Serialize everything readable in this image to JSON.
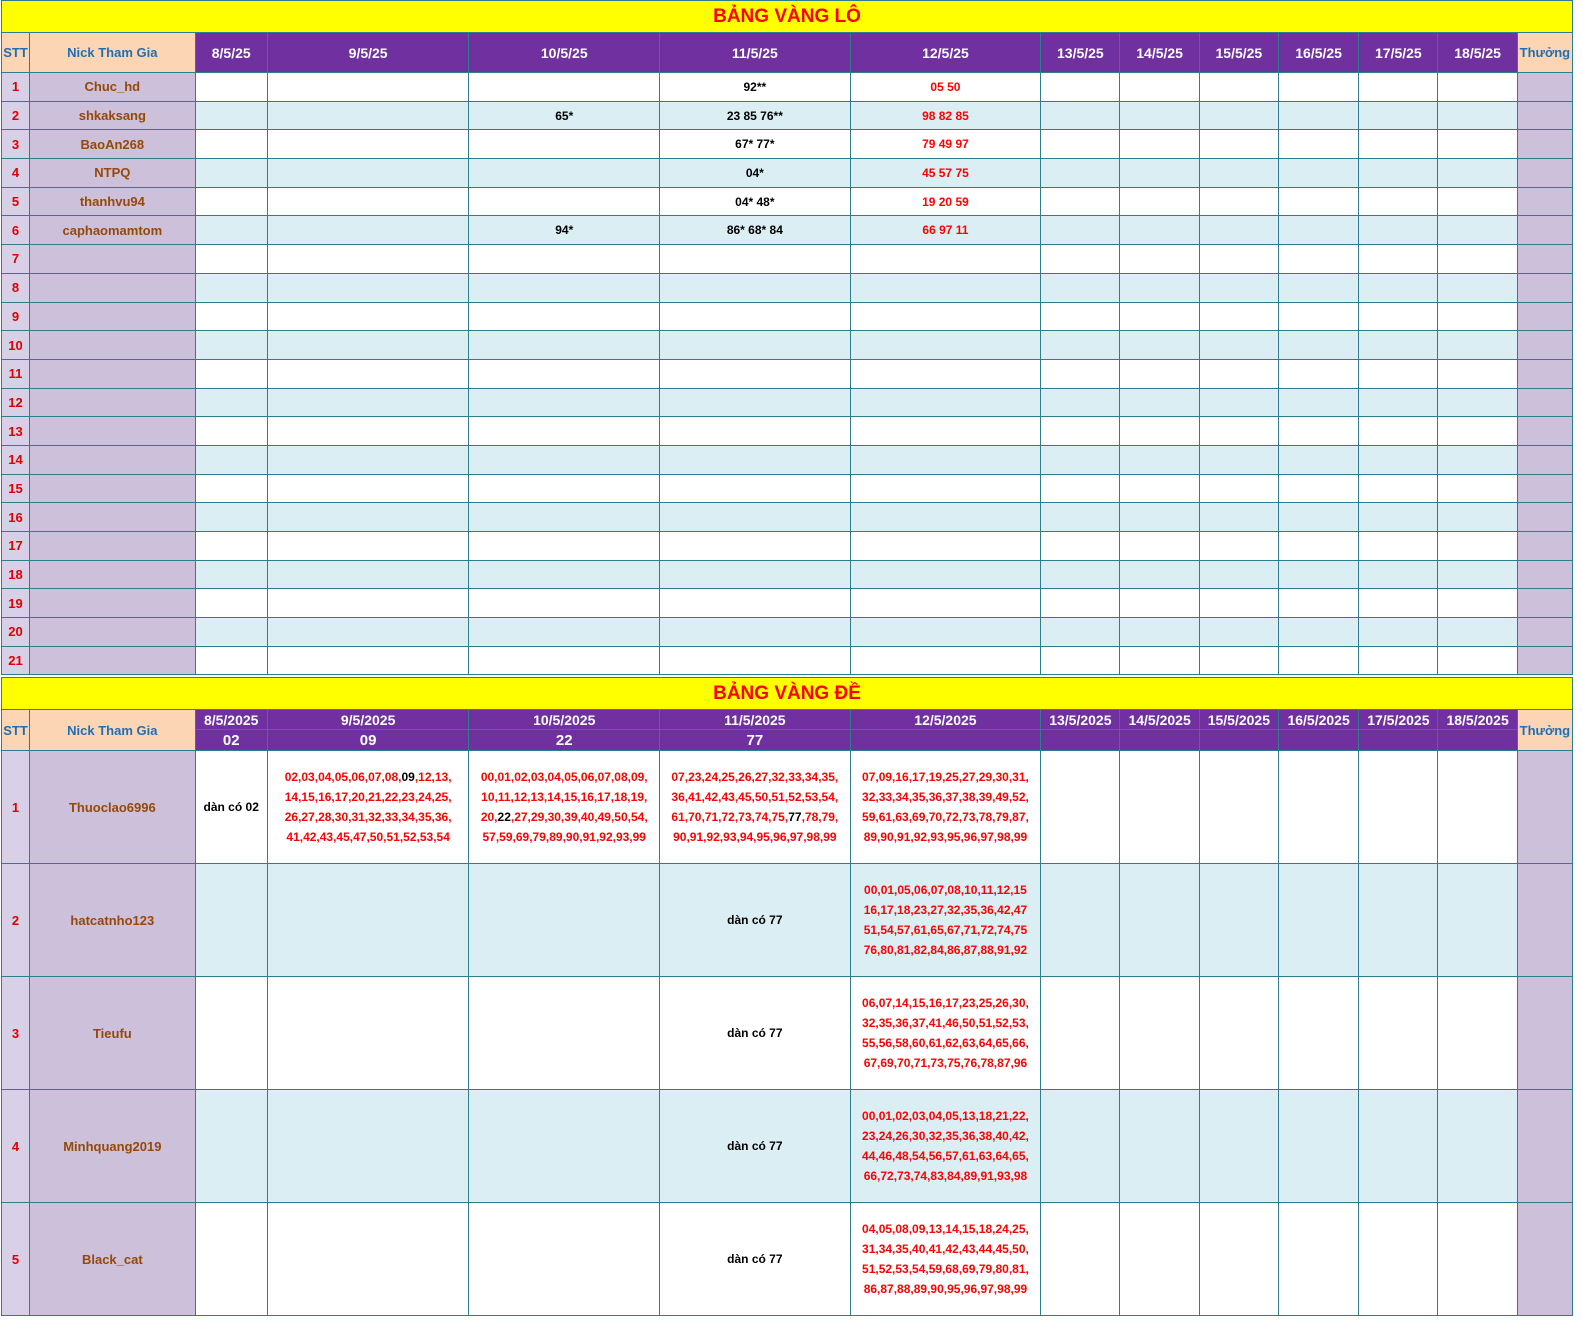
{
  "lo": {
    "title": "BẢNG VÀNG LÔ",
    "headers": {
      "stt": "STT",
      "nick": "Nick Tham Gia",
      "thuong": "Thưởng"
    },
    "dates": [
      "8/5/25",
      "9/5/25",
      "10/5/25",
      "11/5/25",
      "12/5/25",
      "13/5/25",
      "14/5/25",
      "15/5/25",
      "16/5/25",
      "17/5/25",
      "18/5/25"
    ],
    "rows": [
      {
        "stt": "1",
        "nick": "Chuc_hd",
        "cells": [
          "",
          "",
          "",
          "92**",
          "05 50",
          "",
          "",
          "",
          "",
          "",
          ""
        ]
      },
      {
        "stt": "2",
        "nick": "shkaksang",
        "cells": [
          "",
          "",
          "65*",
          "23 85 76**",
          "98 82 85",
          "",
          "",
          "",
          "",
          "",
          ""
        ]
      },
      {
        "stt": "3",
        "nick": "BaoAn268",
        "cells": [
          "",
          "",
          "",
          "67* 77*",
          "79 49 97",
          "",
          "",
          "",
          "",
          "",
          ""
        ]
      },
      {
        "stt": "4",
        "nick": "NTPQ",
        "cells": [
          "",
          "",
          "",
          "04*",
          "45 57 75",
          "",
          "",
          "",
          "",
          "",
          ""
        ]
      },
      {
        "stt": "5",
        "nick": "thanhvu94",
        "cells": [
          "",
          "",
          "",
          "04* 48*",
          "19 20 59",
          "",
          "",
          "",
          "",
          "",
          ""
        ]
      },
      {
        "stt": "6",
        "nick": "caphaomamtom",
        "cells": [
          "",
          "",
          "94*",
          "86* 68* 84",
          "66 97 11",
          "",
          "",
          "",
          "",
          "",
          ""
        ]
      },
      {
        "stt": "7",
        "nick": "",
        "cells": [
          "",
          "",
          "",
          "",
          "",
          "",
          "",
          "",
          "",
          "",
          ""
        ]
      },
      {
        "stt": "8",
        "nick": "",
        "cells": [
          "",
          "",
          "",
          "",
          "",
          "",
          "",
          "",
          "",
          "",
          ""
        ]
      },
      {
        "stt": "9",
        "nick": "",
        "cells": [
          "",
          "",
          "",
          "",
          "",
          "",
          "",
          "",
          "",
          "",
          ""
        ]
      },
      {
        "stt": "10",
        "nick": "",
        "cells": [
          "",
          "",
          "",
          "",
          "",
          "",
          "",
          "",
          "",
          "",
          ""
        ]
      },
      {
        "stt": "11",
        "nick": "",
        "cells": [
          "",
          "",
          "",
          "",
          "",
          "",
          "",
          "",
          "",
          "",
          ""
        ]
      },
      {
        "stt": "12",
        "nick": "",
        "cells": [
          "",
          "",
          "",
          "",
          "",
          "",
          "",
          "",
          "",
          "",
          ""
        ]
      },
      {
        "stt": "13",
        "nick": "",
        "cells": [
          "",
          "",
          "",
          "",
          "",
          "",
          "",
          "",
          "",
          "",
          ""
        ]
      },
      {
        "stt": "14",
        "nick": "",
        "cells": [
          "",
          "",
          "",
          "",
          "",
          "",
          "",
          "",
          "",
          "",
          ""
        ]
      },
      {
        "stt": "15",
        "nick": "",
        "cells": [
          "",
          "",
          "",
          "",
          "",
          "",
          "",
          "",
          "",
          "",
          ""
        ]
      },
      {
        "stt": "16",
        "nick": "",
        "cells": [
          "",
          "",
          "",
          "",
          "",
          "",
          "",
          "",
          "",
          "",
          ""
        ]
      },
      {
        "stt": "17",
        "nick": "",
        "cells": [
          "",
          "",
          "",
          "",
          "",
          "",
          "",
          "",
          "",
          "",
          ""
        ]
      },
      {
        "stt": "18",
        "nick": "",
        "cells": [
          "",
          "",
          "",
          "",
          "",
          "",
          "",
          "",
          "",
          "",
          ""
        ]
      },
      {
        "stt": "19",
        "nick": "",
        "cells": [
          "",
          "",
          "",
          "",
          "",
          "",
          "",
          "",
          "",
          "",
          ""
        ]
      },
      {
        "stt": "20",
        "nick": "",
        "cells": [
          "",
          "",
          "",
          "",
          "",
          "",
          "",
          "",
          "",
          "",
          ""
        ]
      },
      {
        "stt": "21",
        "nick": "",
        "cells": [
          "",
          "",
          "",
          "",
          "",
          "",
          "",
          "",
          "",
          "",
          ""
        ]
      }
    ],
    "colors": {
      "lo_day5": "#ff0000",
      "default": "#000000"
    }
  },
  "de": {
    "title": "BẢNG VÀNG ĐỀ",
    "headers": {
      "stt": "STT",
      "nick": "Nick Tham Gia",
      "thuong": "Thưởng"
    },
    "dates": [
      "8/5/2025",
      "9/5/2025",
      "10/5/2025",
      "11/5/2025",
      "12/5/2025",
      "13/5/2025",
      "14/5/2025",
      "15/5/2025",
      "16/5/2025",
      "17/5/2025",
      "18/5/2025"
    ],
    "results": [
      "02",
      "09",
      "22",
      "77",
      "",
      "",
      "",
      "",
      "",
      "",
      ""
    ],
    "rows": [
      {
        "stt": "1",
        "nick": "Thuoclao6996",
        "cells": [
          [
            {
              "t": "dàn có 02",
              "b": true
            }
          ],
          [
            {
              "t": "02,03,04,05,06,07,08,"
            },
            {
              "t": "09",
              "b": true
            },
            {
              "t": ",12,13,\n14,15,16,17,20,21,22,23,24,25,\n26,27,28,30,31,32,33,34,35,36,\n41,42,43,45,47,50,51,52,53,54"
            }
          ],
          [
            {
              "t": "00,01,02,03,04,05,06,07,08,09,\n10,11,12,13,14,15,16,17,18,19,\n20,"
            },
            {
              "t": "22",
              "b": true
            },
            {
              "t": ",27,29,30,39,40,49,50,54,\n57,59,69,79,89,90,91,92,93,99"
            }
          ],
          [
            {
              "t": "07,23,24,25,26,27,32,33,34,35,\n36,41,42,43,45,50,51,52,53,54,\n61,70,71,72,73,74,75,"
            },
            {
              "t": "77",
              "b": true
            },
            {
              "t": ",78,79,\n90,91,92,93,94,95,96,97,98,99"
            }
          ],
          [
            {
              "t": "07,09,16,17,19,25,27,29,30,31,\n32,33,34,35,36,37,38,39,49,52,\n59,61,63,69,70,72,73,78,79,87,\n89,90,91,92,93,95,96,97,98,99"
            }
          ],
          [],
          [],
          [],
          [],
          [],
          []
        ]
      },
      {
        "stt": "2",
        "nick": "hatcatnho123",
        "cells": [
          [],
          [],
          [],
          [
            {
              "t": "dàn có 77",
              "b": true
            }
          ],
          [
            {
              "t": "00,01,05,06,07,08,10,11,12,15\n16,17,18,23,27,32,35,36,42,47\n51,54,57,61,65,67,71,72,74,75\n76,80,81,82,84,86,87,88,91,92"
            }
          ],
          [],
          [],
          [],
          [],
          [],
          []
        ]
      },
      {
        "stt": "3",
        "nick": "Tieufu",
        "cells": [
          [],
          [],
          [],
          [
            {
              "t": "dàn có 77",
              "b": true
            }
          ],
          [
            {
              "t": "06,07,14,15,16,17,23,25,26,30,\n32,35,36,37,41,46,50,51,52,53,\n55,56,58,60,61,62,63,64,65,66,\n67,69,70,71,73,75,76,78,87,96"
            }
          ],
          [],
          [],
          [],
          [],
          [],
          []
        ]
      },
      {
        "stt": "4",
        "nick": "Minhquang2019",
        "cells": [
          [],
          [],
          [],
          [
            {
              "t": "dàn có 77",
              "b": true
            }
          ],
          [
            {
              "t": "00,01,02,03,04,05,13,18,21,22,\n23,24,26,30,32,35,36,38,40,42,\n44,46,48,54,56,57,61,63,64,65,\n66,72,73,74,83,84,89,91,93,98"
            }
          ],
          [],
          [],
          [],
          [],
          [],
          []
        ]
      },
      {
        "stt": "5",
        "nick": "Black_cat",
        "cells": [
          [],
          [],
          [],
          [
            {
              "t": "dàn có 77",
              "b": true
            }
          ],
          [
            {
              "t": "04,05,08,09,13,14,15,18,24,25,\n31,34,35,40,41,42,43,44,45,50,\n51,52,53,54,59,68,69,79,80,81,\n86,87,88,89,90,95,96,97,98,99"
            }
          ],
          [],
          [],
          [],
          [],
          [],
          []
        ]
      }
    ]
  }
}
